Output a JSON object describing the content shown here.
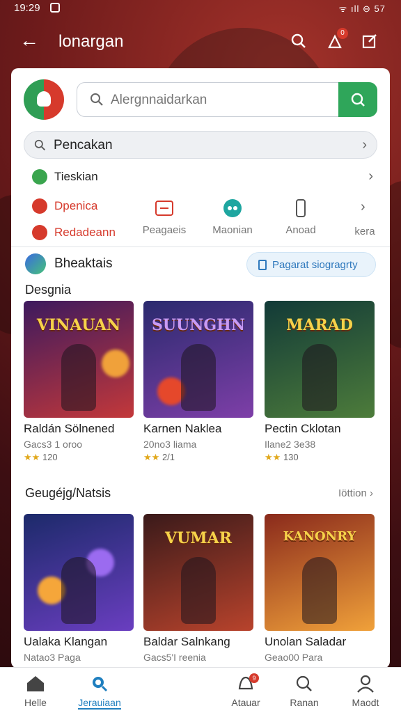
{
  "status": {
    "time": "19:29",
    "indicators": "ᯤ ıll ⊖ 57"
  },
  "topbar": {
    "title": "lonargan",
    "notif_count": "0"
  },
  "search": {
    "placeholder": "Alergnnaidarkan"
  },
  "quick_search": {
    "label": "Pencakan"
  },
  "rows": [
    {
      "label": "Tieskian",
      "color": "#3aa54e"
    },
    {
      "label": "Dpenica",
      "color": "#d63a2c"
    },
    {
      "label": "Redadeann",
      "color": "#d63a2c"
    }
  ],
  "categories": [
    {
      "label": "Peagaeis",
      "icon": "ticket-icon"
    },
    {
      "label": "Maonian",
      "icon": "gamepad-icon"
    },
    {
      "label": "Anoad",
      "icon": "phone-icon"
    },
    {
      "label": "kera",
      "icon": "more-icon"
    }
  ],
  "section1": {
    "title": "Bheaktais",
    "chip": "Pagarat siogragrty",
    "subtitle": "Desgnia"
  },
  "games_row1": [
    {
      "name": "Raldán Sölnened",
      "sub": "Gacs3 1 oroo",
      "rating": "120",
      "logo": "VINAUAN",
      "bg": [
        "#3d1a5e",
        "#c3383a"
      ]
    },
    {
      "name": "Karnen Naklea",
      "sub": "20no3 liama",
      "rating": "2/1",
      "logo": "SUUNGHN",
      "bg": [
        "#2a2a6e",
        "#7e3fa8"
      ]
    },
    {
      "name": "Pectin Cklotan",
      "sub": "Ilane2 3e38",
      "rating": "130",
      "logo": "MARAD",
      "bg": [
        "#123a38",
        "#4d7c3a"
      ]
    }
  ],
  "section2": {
    "title": "Geugéjg/Natsis",
    "see_all": "Iöttion"
  },
  "games_row2": [
    {
      "name": "Ualaka Klangan",
      "sub": "Natao3 Paga",
      "logo": "",
      "bg": [
        "#1c2a6a",
        "#6a3ec0"
      ]
    },
    {
      "name": "Baldar Salnkang",
      "sub": "Gacs5'I reenia",
      "logo": "VUMAR",
      "bg": [
        "#3a1a1a",
        "#b8432c"
      ]
    },
    {
      "name": "Unolan Saladar",
      "sub": "Geao00 Para",
      "logo": "KANONRY",
      "bg": [
        "#8a2a1c",
        "#f0a13a"
      ]
    }
  ],
  "bottom_nav": [
    {
      "label": "Helle",
      "icon": "home-icon",
      "active": false
    },
    {
      "label": "Jerauiaan",
      "icon": "search-icon",
      "active": true
    },
    {
      "label": "Atauar",
      "icon": "bell-icon",
      "badge": "9",
      "active": false
    },
    {
      "label": "Ranan",
      "icon": "search-icon",
      "active": false
    },
    {
      "label": "Maodt",
      "icon": "user-icon",
      "active": false
    }
  ],
  "colors": {
    "accent_green": "#2fa65a",
    "accent_blue": "#1f7fbf",
    "accent_red": "#d63a2c"
  }
}
